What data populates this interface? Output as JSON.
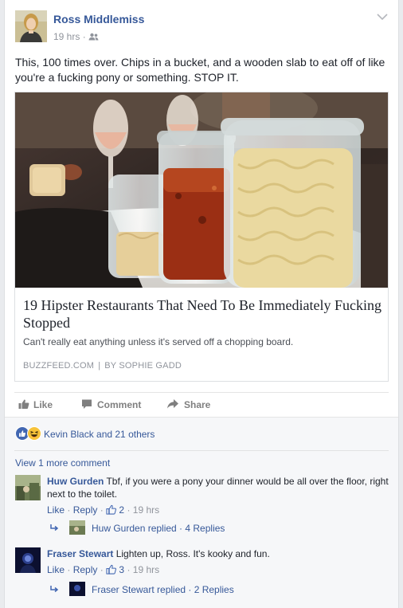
{
  "post": {
    "author": "Ross Middlemiss",
    "time": "19 hrs",
    "dot": "·",
    "text": "This, 100 times over. Chips in a bucket, and a wooden slab to eat off of like you're a fucking pony or something. STOP IT."
  },
  "link": {
    "title": "19 Hipster Restaurants That Need To Be Immediately Fucking Stopped",
    "description": "Can't really eat anything unless it's served off a chopping board.",
    "source": "BUZZFEED.COM",
    "separator": "|",
    "byline": "BY SOPHIE GADD"
  },
  "actions": {
    "like": "Like",
    "comment": "Comment",
    "share": "Share"
  },
  "reactions": {
    "summary": "Kevin Black and 21 others"
  },
  "comments_section": {
    "view_more": "View 1 more comment",
    "comments": [
      {
        "author": "Huw Gurden",
        "text": "Tbf, if you were a pony your dinner would be all over the floor, right next to the toilet.",
        "like_label": "Like",
        "reply_label": "Reply",
        "dot": "·",
        "like_count": "2",
        "time": "19 hrs",
        "replies_text": "Huw Gurden replied · 4 Replies"
      },
      {
        "author": "Fraser Stewart",
        "text": "Lighten up, Ross. It's kooky and fun.",
        "like_label": "Like",
        "reply_label": "Reply",
        "dot": "·",
        "like_count": "3",
        "time": "19 hrs",
        "replies_text": "Fraser Stewart replied · 2 Replies"
      }
    ]
  },
  "colors": {
    "link_blue": "#365899",
    "like_blue": "#4267b2",
    "muted": "#90949c",
    "background": "#e9ebee"
  },
  "icons": [
    "friends-icon",
    "chevron-down-icon",
    "like-icon",
    "comment-icon",
    "share-icon",
    "like-reaction-icon",
    "haha-reaction-icon",
    "thumbs-up-icon",
    "reply-arrow-icon"
  ]
}
